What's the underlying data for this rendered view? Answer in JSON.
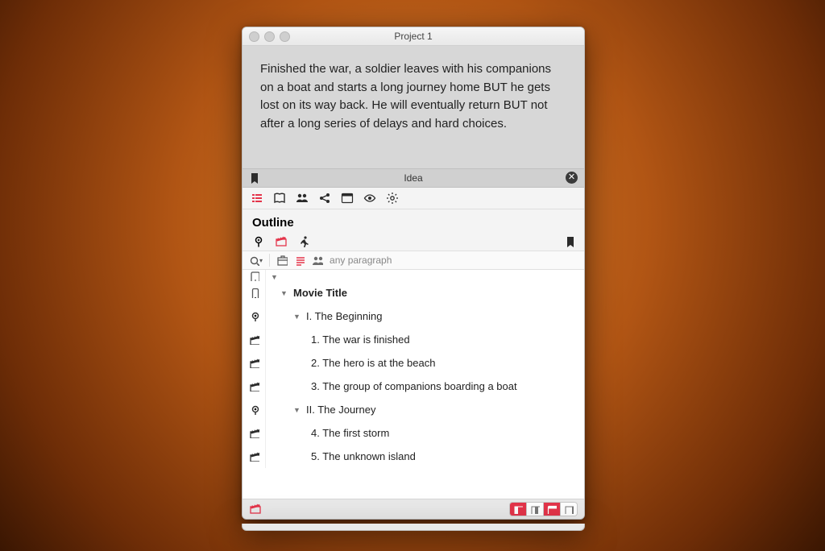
{
  "window": {
    "title": "Project 1"
  },
  "idea": {
    "text": "Finished the war, a soldier leaves with his companions on a boat and starts a long journey home BUT he gets lost on its way back. He will eventually return BUT not after a long series of delays and hard choices.",
    "label": "Idea"
  },
  "section": {
    "title": "Outline"
  },
  "filter": {
    "placeholder": "any paragraph"
  },
  "outline": {
    "toprow": "",
    "root": "Movie Title",
    "act1": {
      "label": "I. The Beginning",
      "scenes": [
        "1. The war is finished",
        "2. The hero is at the beach",
        "3. The group of companions boarding a boat"
      ]
    },
    "act2": {
      "label": "II. The Journey",
      "scenes": [
        "4. The first storm",
        "5. The unknown island"
      ]
    }
  },
  "colors": {
    "accent": "#e4344a"
  }
}
